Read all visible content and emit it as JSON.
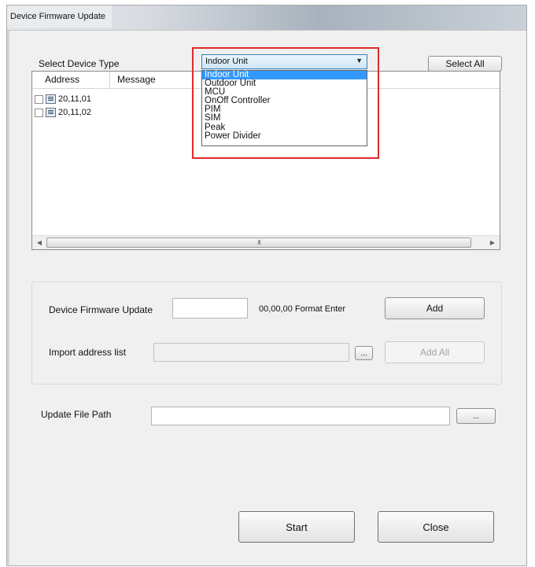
{
  "window": {
    "title": "Device Firmware Update"
  },
  "device_type": {
    "label": "Select Device Type",
    "selected": "Indoor Unit",
    "options": [
      "Indoor Unit",
      "Outdoor Unit",
      "MCU",
      "OnOff Controller",
      "PIM",
      "SIM",
      "Peak",
      "Power Divider"
    ],
    "select_all_label": "Select All"
  },
  "device_list": {
    "columns": [
      "Address",
      "Message"
    ],
    "rows": [
      {
        "address": "20,11,01",
        "checked": false
      },
      {
        "address": "20,11,02",
        "checked": false
      }
    ],
    "scroll_thumb_glyph": "III"
  },
  "firmware_group": {
    "device_update_label": "Device Firmware Update",
    "device_update_value": "",
    "format_hint": "00,00,00 Format Enter",
    "add_label": "Add",
    "import_label": "Import address list",
    "import_value": "",
    "browse_label": "...",
    "add_all_label": "Add All"
  },
  "update_file": {
    "label": "Update File Path",
    "value": "",
    "browse_label": "..."
  },
  "footer": {
    "start_label": "Start",
    "close_label": "Close"
  }
}
